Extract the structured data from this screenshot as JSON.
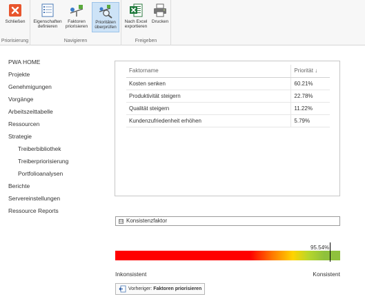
{
  "ribbon": {
    "groups": [
      {
        "label": "Priorisierung",
        "buttons": [
          {
            "label": "Schließen",
            "icon": "close-icon"
          }
        ]
      },
      {
        "label": "Navigieren",
        "buttons": [
          {
            "label1": "Eigenschaften",
            "label2": "definieren",
            "icon": "properties-icon"
          },
          {
            "label1": "Faktoren",
            "label2": "priorisieren",
            "icon": "prioritize-icon"
          },
          {
            "label1": "Prioritäten",
            "label2": "überprüfen",
            "icon": "review-priorities-icon"
          }
        ]
      },
      {
        "label": "Freigeben",
        "buttons": [
          {
            "label1": "Nach Excel",
            "label2": "exportieren",
            "icon": "excel-icon"
          },
          {
            "label": "Drucken",
            "icon": "printer-icon"
          }
        ]
      }
    ]
  },
  "nav": {
    "items": [
      {
        "label": "PWA HOME"
      },
      {
        "label": "Projekte"
      },
      {
        "label": "Genehmigungen"
      },
      {
        "label": "Vorgänge"
      },
      {
        "label": "Arbeitszeittabelle"
      },
      {
        "label": "Ressourcen"
      },
      {
        "label": "Strategie"
      },
      {
        "label": "Treiberbibliothek"
      },
      {
        "label": "Treiberpriorisierung"
      },
      {
        "label": "Portfolioanalysen"
      },
      {
        "label": "Berichte"
      },
      {
        "label": "Servereinstellungen"
      },
      {
        "label": "Ressource Reports"
      }
    ]
  },
  "table": {
    "columns": [
      "Faktorname",
      "Priorität ↓"
    ],
    "rows": [
      {
        "name": "Kosten senken",
        "priority": "60.21%"
      },
      {
        "name": "Produktivität steigern",
        "priority": "22.78%"
      },
      {
        "name": "Qualität steigern",
        "priority": "11.22%"
      },
      {
        "name": "Kundenzufriedenheit erhöhen",
        "priority": "5.79%"
      }
    ]
  },
  "consistency": {
    "header_toggle": "⊟",
    "header": "Konsistenzfaktor",
    "value_label": "95.54%",
    "value": 0.9554,
    "left_label": "Inkonsistent",
    "right_label": "Konsistent"
  },
  "previous_button": {
    "prefix": "Vorheriger:",
    "target": "Faktoren priorisieren",
    "icon": "back-page-icon"
  }
}
